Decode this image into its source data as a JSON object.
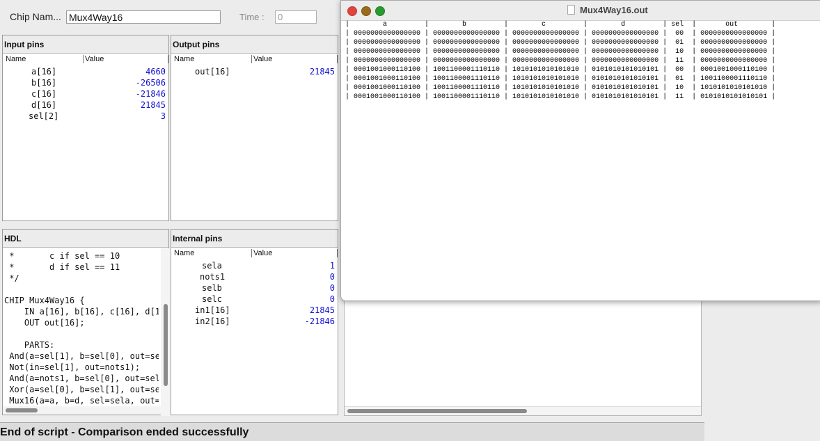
{
  "toolbar": {
    "chip_name_label": "Chip Nam...",
    "chip_name_value": "Mux4Way16",
    "time_label": "Time :",
    "time_value": "0"
  },
  "input_pins": {
    "title": "Input pins",
    "col_name": "Name",
    "col_value": "Value",
    "rows": [
      {
        "name": "a[16]",
        "value": "4660"
      },
      {
        "name": "b[16]",
        "value": "-26506"
      },
      {
        "name": "c[16]",
        "value": "-21846"
      },
      {
        "name": "d[16]",
        "value": "21845"
      },
      {
        "name": "sel[2]",
        "value": "3"
      }
    ]
  },
  "output_pins": {
    "title": "Output pins",
    "col_name": "Name",
    "col_value": "Value",
    "rows": [
      {
        "name": "out[16]",
        "value": "21845"
      }
    ]
  },
  "hdl": {
    "title": "HDL",
    "code": " *       c if sel == 10\n *       d if sel == 11\n */\n\nCHIP Mux4Way16 {\n    IN a[16], b[16], c[16], d[16\n    OUT out[16];\n\n    PARTS:\n And(a=sel[1], b=sel[0], out=sel\n Not(in=sel[1], out=nots1);\n And(a=nots1, b=sel[0], out=selb\n Xor(a=sel[0], b=sel[1], out=sel\n Mux16(a=a, b=d, sel=sela, out=i"
  },
  "internal_pins": {
    "title": "Internal pins",
    "col_name": "Name",
    "col_value": "Value",
    "rows": [
      {
        "name": "sela",
        "value": "1"
      },
      {
        "name": "nots1",
        "value": "0"
      },
      {
        "name": "selb",
        "value": "0"
      },
      {
        "name": "selc",
        "value": "0"
      },
      {
        "name": "in1[16]",
        "value": "21845"
      },
      {
        "name": "in2[16]",
        "value": "-21846"
      }
    ]
  },
  "status": {
    "text": "End of script - Comparison ended successfully"
  },
  "out_window": {
    "title": "Mux4Way16.out",
    "table_text": "|        a         |        b         |        c         |        d         | sel  |       out        |\n| 0000000000000000 | 0000000000000000 | 0000000000000000 | 0000000000000000 |  00  | 0000000000000000 |\n| 0000000000000000 | 0000000000000000 | 0000000000000000 | 0000000000000000 |  01  | 0000000000000000 |\n| 0000000000000000 | 0000000000000000 | 0000000000000000 | 0000000000000000 |  10  | 0000000000000000 |\n| 0000000000000000 | 0000000000000000 | 0000000000000000 | 0000000000000000 |  11  | 0000000000000000 |\n| 0001001000110100 | 1001100001110110 | 1010101010101010 | 0101010101010101 |  00  | 0001001000110100 |\n| 0001001000110100 | 1001100001110110 | 1010101010101010 | 0101010101010101 |  01  | 1001100001110110 |\n| 0001001000110100 | 1001100001110110 | 1010101010101010 | 0101010101010101 |  10  | 1010101010101010 |\n| 0001001000110100 | 1001100001110110 | 1010101010101010 | 0101010101010101 |  11  | 0101010101010101 |"
  },
  "colors": {
    "value_blue": "#1010d0",
    "close_red": "#e0443e",
    "minimize_brown": "#9a6b1a",
    "maximize_green": "#2a9a2e"
  },
  "icons": [
    "document-icon",
    "close-window-icon",
    "minimize-window-icon",
    "maximize-window-icon"
  ]
}
